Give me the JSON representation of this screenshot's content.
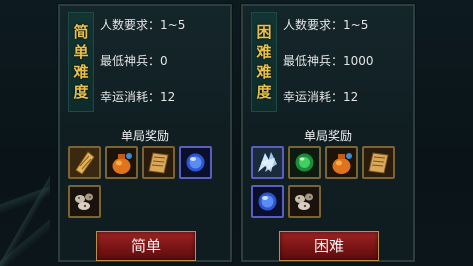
{
  "panels": [
    {
      "difficulty_chars": [
        "简",
        "单",
        "难",
        "度"
      ],
      "stats": [
        {
          "label": "人数要求",
          "value": "1~5"
        },
        {
          "label": "最低神兵",
          "value": "0"
        },
        {
          "label": "幸运消耗",
          "value": "12"
        }
      ],
      "reward_title": "单局奖励",
      "rewards": [
        "scroll-icon",
        "money-bag-icon",
        "book-icon",
        "blue-orb-icon",
        "ore-icon"
      ],
      "button_label": "简单"
    },
    {
      "difficulty_chars": [
        "困",
        "难",
        "难",
        "度"
      ],
      "stats": [
        {
          "label": "人数要求",
          "value": "1~5"
        },
        {
          "label": "最低神兵",
          "value": "1000"
        },
        {
          "label": "幸运消耗",
          "value": "12"
        }
      ],
      "reward_title": "单局奖励",
      "rewards": [
        "crystal-icon",
        "green-orb-icon",
        "money-bag-icon",
        "book-icon",
        "blue-orb-icon",
        "ore-icon"
      ],
      "button_label": "困难"
    }
  ],
  "colors": {
    "difficulty_text": "#e8c14a",
    "button_red": "#9e2424",
    "slot_gold": "#7b6431",
    "slot_blue": "#5a5fbf"
  }
}
